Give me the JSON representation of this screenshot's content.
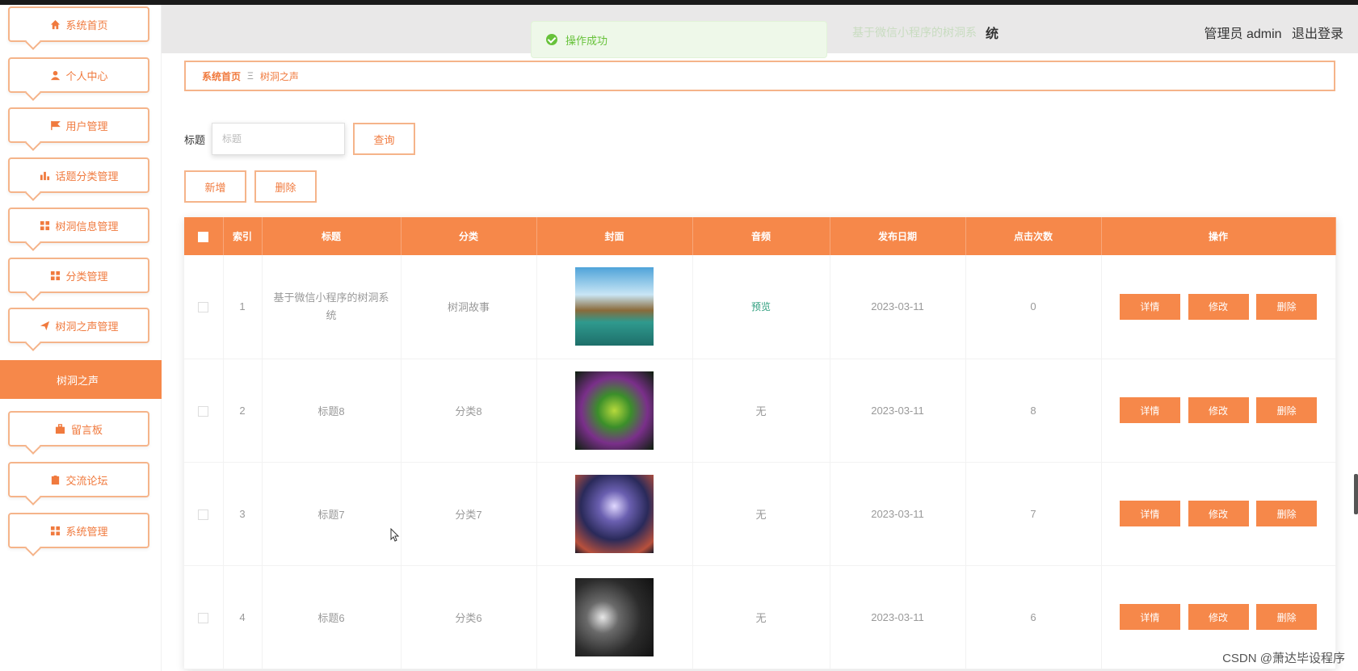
{
  "header": {
    "title_suffix": "统",
    "title_faded": "基于微信小程序的树洞系",
    "admin_label": "管理员 admin",
    "logout_label": "退出登录"
  },
  "toast": {
    "message": "操作成功"
  },
  "sidebar": {
    "items": [
      {
        "label": "系统首页",
        "icon": "home-icon"
      },
      {
        "label": "个人中心",
        "icon": "user-icon"
      },
      {
        "label": "用户管理",
        "icon": "flag-icon"
      },
      {
        "label": "话题分类管理",
        "icon": "bar-chart-icon"
      },
      {
        "label": "树洞信息管理",
        "icon": "grid-icon"
      },
      {
        "label": "分类管理",
        "icon": "grid-icon"
      },
      {
        "label": "树洞之声管理",
        "icon": "send-icon"
      },
      {
        "label": "留言板",
        "icon": "briefcase-icon"
      },
      {
        "label": "交流论坛",
        "icon": "clipboard-icon"
      },
      {
        "label": "系统管理",
        "icon": "grid-icon"
      }
    ],
    "active_sub": "树洞之声"
  },
  "breadcrumb": {
    "home": "系统首页",
    "separator": "Ξ",
    "current": "树洞之声"
  },
  "search": {
    "label": "标题",
    "placeholder": "标题",
    "button": "查询"
  },
  "actions": {
    "add": "新增",
    "delete": "删除"
  },
  "table": {
    "headers": [
      "索引",
      "标题",
      "分类",
      "封面",
      "音频",
      "发布日期",
      "点击次数",
      "操作"
    ],
    "rows": [
      {
        "index": "1",
        "title": "基于微信小程序的树洞系统",
        "category": "树洞故事",
        "audio": "预览",
        "date": "2023-03-11",
        "clicks": "0"
      },
      {
        "index": "2",
        "title": "标题8",
        "category": "分类8",
        "audio": "无",
        "date": "2023-03-11",
        "clicks": "8"
      },
      {
        "index": "3",
        "title": "标题7",
        "category": "分类7",
        "audio": "无",
        "date": "2023-03-11",
        "clicks": "7"
      },
      {
        "index": "4",
        "title": "标题6",
        "category": "分类6",
        "audio": "无",
        "date": "2023-03-11",
        "clicks": "6"
      }
    ],
    "op_buttons": {
      "detail": "详情",
      "edit": "修改",
      "delete": "删除"
    }
  },
  "watermark": "CSDN @萧达毕设程序",
  "colors": {
    "accent": "#f6884a",
    "accent_border": "#f5b48a",
    "success": "#67c23a"
  }
}
